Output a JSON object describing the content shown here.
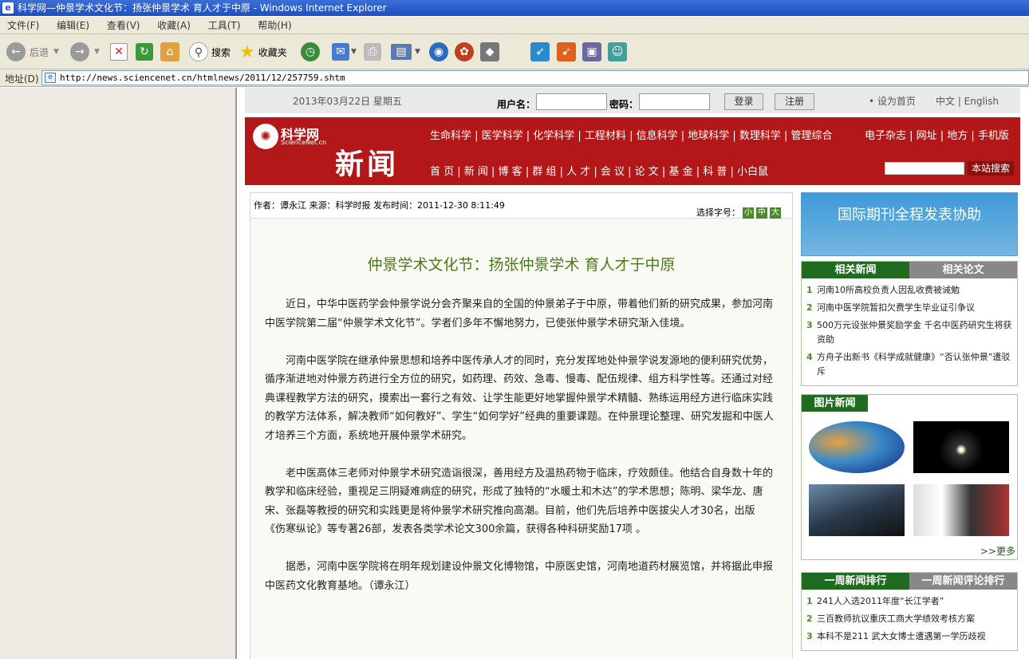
{
  "window": {
    "title": "科学网—仲景学术文化节：扬张仲景学术 育人才于中原 - Windows Internet Explorer"
  },
  "menu": [
    "文件(F)",
    "编辑(E)",
    "查看(V)",
    "收藏(A)",
    "工具(T)",
    "帮助(H)"
  ],
  "toolbar": {
    "back": "后退",
    "search": "搜索",
    "favorites": "收藏夹"
  },
  "address": {
    "label": "地址(D)",
    "url": "http://news.sciencenet.cn/htmlnews/2011/12/257759.shtm"
  },
  "topstrip": {
    "date": "2013年03月22日 星期五",
    "username_label": "用户名：",
    "password_label": "密码：",
    "login": "登录",
    "register": "注册",
    "homepage": "• 设为首页",
    "lang": "中文 | English"
  },
  "banner": {
    "logo_text": "科学网",
    "logo_sub": "ScienceNet.cn",
    "section": "新闻",
    "nav1": "生命科学 | 医学科学 | 化学科学 | 工程材料 | 信息科学 | 地球科学 | 数理科学 | 管理综合",
    "nav1_right": "电子杂志 | 网址 | 地方 | 手机版",
    "nav2": "首 页 | 新 闻 | 博 客 | 群 组 | 人 才 | 会 议 | 论 文 | 基 金 | 科 普 | 小白鼠",
    "search_button": "本站搜索"
  },
  "article": {
    "meta": "作者：谭永江  来源：科学时报  发布时间：2011-12-30 8:11:49",
    "font_label": "选择字号：",
    "font_sizes": [
      "小",
      "中",
      "大"
    ],
    "title": "仲景学术文化节：扬张仲景学术 育人才于中原",
    "paragraphs": [
      "近日，中华中医药学会仲景学说分会齐聚来自的全国的仲景弟子于中原，带着他们新的研究成果，参加河南中医学院第二届“仲景学术文化节”。学者们多年不懈地努力，已使张仲景学术研究渐入佳境。",
      "河南中医学院在继承仲景思想和培养中医传承人才的同时，充分发挥地处仲景学说发源地的便利研究优势，循序渐进地对仲景方药进行全方位的研究，如药理、药效、急毒、慢毒、配伍规律、组方科学性等。还通过对经典课程教学方法的研究，摸索出一套行之有效、让学生能更好地掌握仲景学术精髓、熟练运用经方进行临床实践的教学方法体系，解决教师“如何教好”、学生“如何学好”经典的重要课题。在仲景理论整理、研究发掘和中医人才培养三个方面，系统地开展仲景学术研究。",
      "老中医高体三老师对仲景学术研究造诣很深，善用经方及温热药物于临床，疗效颇佳。他结合自身数十年的教学和临床经验，重视足三阴疑难病症的研究，形成了独特的“水暖土和木达”的学术思想；陈明、梁华龙、唐宋、张磊等教授的研究和实践更是将仲景学术研究推向高潮。目前，他们先后培养中医拔尖人才30名，出版《伤寒纵论》等专著26部，发表各类学术论文300余篇，获得各种科研奖励17项 。",
      "据悉，河南中医学院将在明年规划建设仲景文化博物馆，中原医史馆，河南地道药材展览馆，并将据此申报中医药文化教育基地。（谭永江）"
    ]
  },
  "sidebar": {
    "ad": "国际期刊全程发表协助",
    "related": {
      "tab_on": "相关新闻",
      "tab_off": "相关论文",
      "items": [
        {
          "n": "1",
          "t": "河南10所高校负责人因乱收费被诫勉"
        },
        {
          "n": "2",
          "t": "河南中医学院暂扣欠费学生毕业证引争议"
        },
        {
          "n": "3",
          "t": "500万元设张仲景奖励学金 千名中医药研究生将获资助"
        },
        {
          "n": "4",
          "t": "方舟子出新书《科学成就健康》“否认张仲景”遭驳斥"
        }
      ]
    },
    "photos": {
      "tab": "图片新闻",
      "more": ">>更多"
    },
    "ranking": {
      "tab_on": "一周新闻排行",
      "tab_off": "一周新闻评论排行",
      "items": [
        {
          "n": "1",
          "t": "241人入选2011年度“长江学者”"
        },
        {
          "n": "2",
          "t": "三百教师抗议重庆工商大学绩效考核方案"
        },
        {
          "n": "3",
          "t": "本科不是211 武大女博士遭遇第一学历歧视"
        }
      ]
    }
  }
}
